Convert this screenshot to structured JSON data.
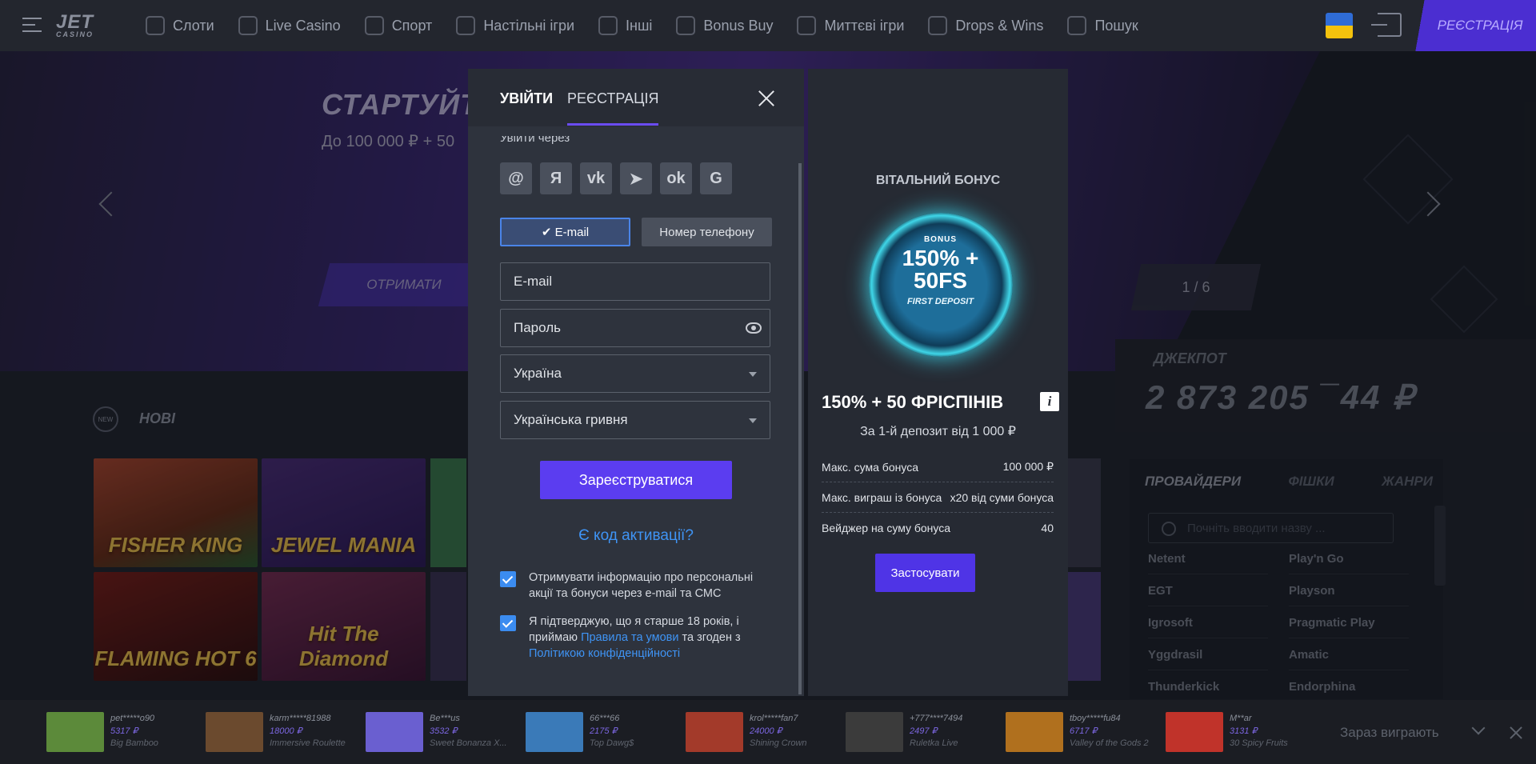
{
  "header": {
    "logo": "JET",
    "logo_sub": "CASINO",
    "nav": [
      {
        "label": "Слоти",
        "icon": "slots-icon"
      },
      {
        "label": "Live Casino",
        "icon": "live-dealer-icon"
      },
      {
        "label": "Спорт",
        "icon": "sport-icon"
      },
      {
        "label": "Настільні ігри",
        "icon": "table-games-icon"
      },
      {
        "label": "Інші",
        "icon": "other-games-icon"
      },
      {
        "label": "Bonus Buy",
        "icon": "bonus-buy-icon"
      },
      {
        "label": "Миттєві ігри",
        "icon": "instant-games-icon"
      },
      {
        "label": "Drops & Wins",
        "icon": "drops-wins-icon"
      },
      {
        "label": "Пошук",
        "icon": "search-icon"
      }
    ],
    "register_label": "РЕЄСТРАЦІЯ",
    "flag": {
      "top": "#2f6cd6",
      "bottom": "#f4c20d"
    }
  },
  "banner": {
    "title": "СТАРТУЙТ",
    "subtitle": "До 100 000 ₽ + 50",
    "cta": "ОТРИМАТИ",
    "counter": "1 / 6"
  },
  "jackpot": {
    "label": "ДЖЕКПОТ",
    "value": "2 873 205 ¯44 ₽"
  },
  "new_games": {
    "label": "НОВІ",
    "badge": "NEW",
    "tiles": [
      {
        "title": "FISHER KING"
      },
      {
        "title": "JEWEL MANIA"
      },
      {
        "title": "FLAMING HOT 6"
      },
      {
        "title": "Hit The Diamond"
      }
    ]
  },
  "providers": {
    "tabs": [
      "ПРОВАЙДЕРИ",
      "ФІШКИ",
      "ЖАНРИ"
    ],
    "search_placeholder": "Почніть вводити назву ...",
    "items": [
      "Netent",
      "Play'n Go",
      "EGT",
      "Playson",
      "Igrosoft",
      "Pragmatic Play",
      "Yggdrasil",
      "Amatic",
      "Thunderkick",
      "Endorphina"
    ]
  },
  "modal": {
    "tab_login": "УВІЙТИ",
    "tab_register": "РЕЄСТРАЦІЯ",
    "social_label": "Увійти через",
    "socials": [
      {
        "icon": "mail-ru-icon",
        "glyph": "@"
      },
      {
        "icon": "yandex-icon",
        "glyph": "Я"
      },
      {
        "icon": "vk-icon",
        "glyph": "vk"
      },
      {
        "icon": "telegram-icon",
        "glyph": "➤"
      },
      {
        "icon": "odnoklassniki-icon",
        "glyph": "ok"
      },
      {
        "icon": "google-icon",
        "glyph": "G"
      }
    ],
    "switch_email": "✔ E-mail",
    "switch_phone": "Номер телефону",
    "email_placeholder": "E-mail",
    "password_placeholder": "Пароль",
    "country": "Україна",
    "currency": "Українська гривня",
    "submit": "Зареєструватися",
    "promo_link": "Є код активації?",
    "consent1": "Отримувати інформацію про персональні акції та бонуси через e-mail та СМС",
    "consent2_pre": "Я підтверджую, що я старше 18 років, і приймаю",
    "consent2_link1": "Правила та умови",
    "consent2_mid": "та згоден з",
    "consent2_link2": "Політикою конфіденційності"
  },
  "bonus": {
    "title": "ВІТАЛЬНИЙ БОНУС",
    "badge_top": "BONUS",
    "badge_main": "150% + 50FS",
    "badge_arc": "FIRST DEPOSIT",
    "offer": "150% + 50 ФРІСПІНІВ",
    "deposit_note": "За 1-й депозит від 1 000 ₽",
    "rows": [
      {
        "label": "Макс. сума бонуса",
        "value": "100 000 ₽"
      },
      {
        "label": "Макс. виграш із бонуса",
        "value": "x20 від суми бонуса"
      },
      {
        "label": "Вейджер на суму бонуса",
        "value": "40"
      }
    ],
    "apply": "Застосувати"
  },
  "now_playing": {
    "label": "Зараз виграють",
    "wins": [
      {
        "user": "pet*****o90",
        "amount": "5317 ₽",
        "game": "Big Bamboo",
        "color": "#5c8a3a"
      },
      {
        "user": "karm*****81988",
        "amount": "18000 ₽",
        "game": "Immersive Roulette",
        "color": "#6b4a2e"
      },
      {
        "user": "Be***us",
        "amount": "3532 ₽",
        "game": "Sweet Bonanza X...",
        "color": "#6a5fd0"
      },
      {
        "user": "66***66",
        "amount": "2175 ₽",
        "game": "Top Dawg$",
        "color": "#3a7ab8"
      },
      {
        "user": "krol*****fan7",
        "amount": "24000 ₽",
        "game": "Shining Crown",
        "color": "#a33a2a"
      },
      {
        "user": "+777****7494",
        "amount": "2497 ₽",
        "game": "Ruletka Live",
        "color": "#3b3b3b"
      },
      {
        "user": "tboy*****fu84",
        "amount": "6717 ₽",
        "game": "Valley of the Gods 2",
        "color": "#b0701e"
      },
      {
        "user": "M**ar",
        "amount": "3131 ₽",
        "game": "30 Spicy Fruits",
        "color": "#c0332a"
      }
    ]
  }
}
